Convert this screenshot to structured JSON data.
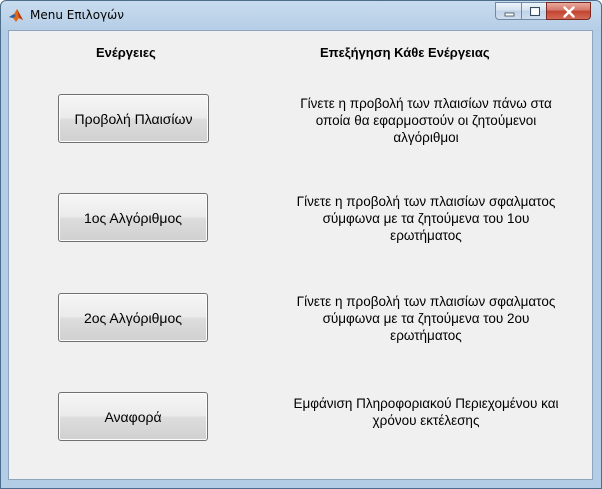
{
  "window": {
    "title": "Menu Επιλογών",
    "controls": {
      "minimize_icon": "minimize-icon",
      "maximize_icon": "maximize-icon",
      "close_icon": "close-icon"
    }
  },
  "headers": {
    "actions": "Ενέργειες",
    "explanation": "Επεξήγηση Κάθε Ενέργειας"
  },
  "actions": [
    {
      "label": "Προβολή Πλαισίων",
      "description": "Γίνετε η προβολή των πλαισίων πάνω στα οποία θα εφαρμοστούν οι ζητούμενοι αλγόριθμοι"
    },
    {
      "label": "1ος Αλγόριθμος",
      "description": "Γίνετε η προβολή των πλαισίων σφαλματος σύμφωνα με τα ζητούμενα του 1ου ερωτήματος"
    },
    {
      "label": "2ος Αλγόριθμος",
      "description": "Γίνετε η προβολή των πλαισίων σφαλματος σύμφωνα με τα ζητούμενα του 2ου ερωτήματος"
    },
    {
      "label": "Αναφορά",
      "description": "Εμφάνιση Πληροφοριακού Περιεχομένου και χρόνου εκτέλεσης"
    }
  ],
  "colors": {
    "titlebar": "#b4cde6",
    "client_bg": "#f0f0f0",
    "close_button": "#c2432f"
  }
}
